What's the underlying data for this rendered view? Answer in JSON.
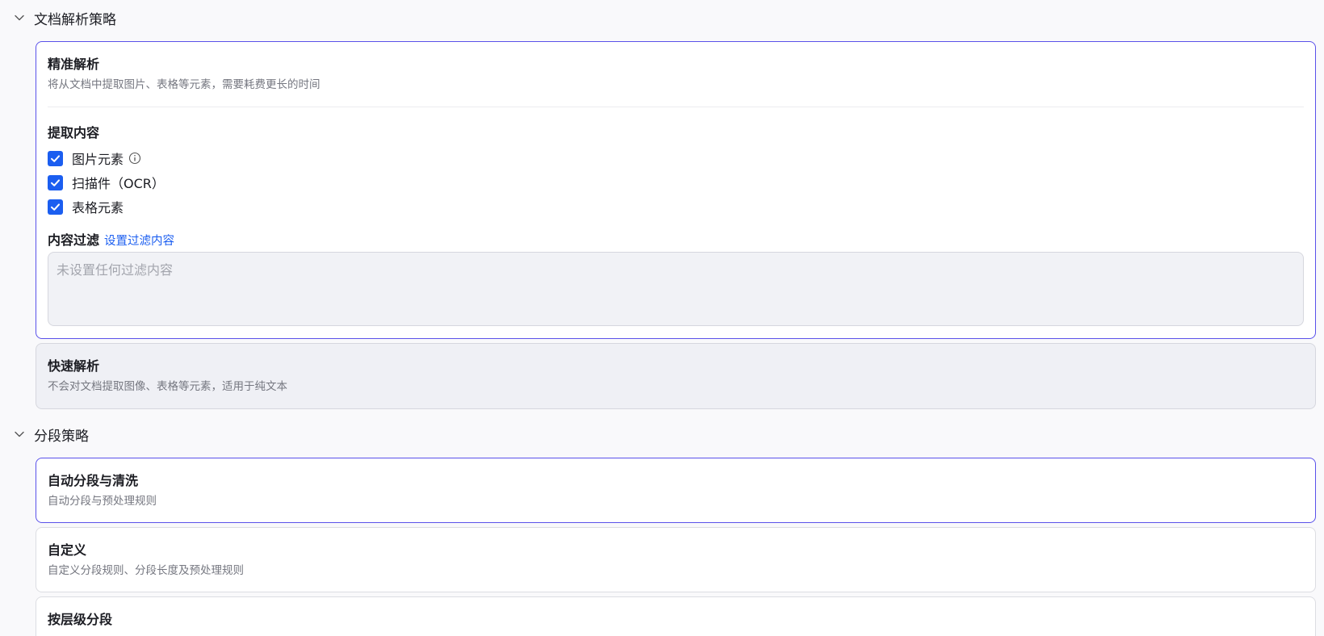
{
  "parse_section": {
    "title": "文档解析策略",
    "precise": {
      "title": "精准解析",
      "desc": "将从文档中提取图片、表格等元素，需要耗费更长的时间",
      "extract_title": "提取内容",
      "options": [
        {
          "label": "图片元素",
          "checked": true
        },
        {
          "label": "扫描件（OCR）",
          "checked": true
        },
        {
          "label": "表格元素",
          "checked": true
        }
      ],
      "filter_label": "内容过滤",
      "filter_link": "设置过滤内容",
      "filter_placeholder": "未设置任何过滤内容"
    },
    "fast": {
      "title": "快速解析",
      "desc": "不会对文档提取图像、表格等元素，适用于纯文本"
    }
  },
  "segment_section": {
    "title": "分段策略",
    "options": [
      {
        "title": "自动分段与清洗",
        "desc": "自动分段与预处理规则",
        "selected": true
      },
      {
        "title": "自定义",
        "desc": "自定义分段规则、分段长度及预处理规则",
        "selected": false
      },
      {
        "title": "按层级分段",
        "desc": "",
        "selected": false
      }
    ]
  },
  "colors": {
    "accent": "#5a51ea",
    "checkbox": "#1b5ef0",
    "link": "#1b5ef0"
  }
}
